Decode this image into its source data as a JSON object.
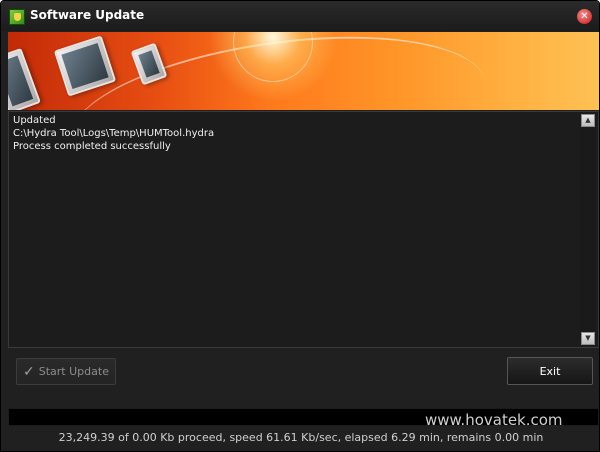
{
  "window": {
    "title": "Software Update",
    "close_icon": "close-icon"
  },
  "log": {
    "lines": [
      "Updated",
      "C:\\Hydra Tool\\Logs\\Temp\\HUMTool.hydra",
      "Process completed successfully"
    ]
  },
  "buttons": {
    "start_update": "Start Update",
    "exit": "Exit"
  },
  "progress": {
    "fraction": 0.0
  },
  "watermark": "www.hovatek.com",
  "status": "23,249.39 of 0.00 Kb proceed, speed 61.61 Kb/sec, elapsed 6.29 min, remains 0.00 min",
  "colors": {
    "background": "#202020",
    "banner_accent": "#ff7a1c",
    "text": "#f0f0f0"
  }
}
